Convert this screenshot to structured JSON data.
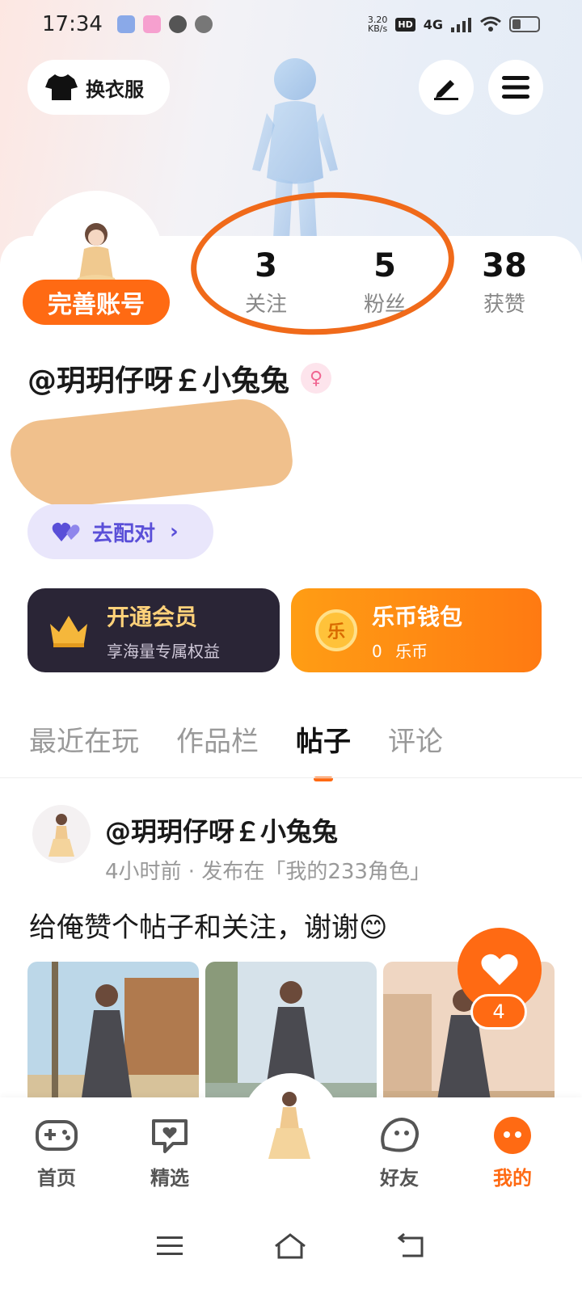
{
  "status_bar": {
    "time": "17:34",
    "net_speed_value": "3.20",
    "net_speed_unit": "KB/s",
    "hd": "HD",
    "network": "4G"
  },
  "header": {
    "outfit_label": "换衣服",
    "edit_icon": "pen-icon",
    "menu_icon": "menu-icon"
  },
  "profile": {
    "complete_label": "完善账号",
    "username": "@玥玥仔呀￡小兔兔",
    "gender": "female",
    "pair_label": "去配对"
  },
  "stats": [
    {
      "value": "3",
      "label": "关注"
    },
    {
      "value": "5",
      "label": "粉丝"
    },
    {
      "value": "38",
      "label": "获赞"
    }
  ],
  "vip": {
    "title": "开通会员",
    "subtitle": "享海量专属权益"
  },
  "wallet": {
    "title": "乐币钱包",
    "coin_symbol": "乐",
    "amount": "0",
    "unit": "乐币"
  },
  "tabs": [
    {
      "label": "最近在玩",
      "active": false
    },
    {
      "label": "作品栏",
      "active": false
    },
    {
      "label": "帖子",
      "active": true
    },
    {
      "label": "评论",
      "active": false
    }
  ],
  "post": {
    "author": "@玥玥仔呀￡小兔兔",
    "meta": "4小时前 · 发布在「我的233角色」",
    "text": "给俺赞个帖子和关注，谢谢😊",
    "like_count": "4"
  },
  "bottom_nav": [
    {
      "label": "首页",
      "icon": "gamepad-icon",
      "active": false
    },
    {
      "label": "精选",
      "icon": "heart-chat-icon",
      "active": false
    },
    {
      "label": "",
      "icon": "avatar-center",
      "active": false
    },
    {
      "label": "好友",
      "icon": "friend-face-icon",
      "active": false
    },
    {
      "label": "我的",
      "icon": "me-face-icon",
      "active": true
    }
  ],
  "colors": {
    "accent": "#ff6a13",
    "pair_bg": "#e9e6fb",
    "vip_bg": "#2a2536",
    "vip_text": "#ffd27a"
  }
}
